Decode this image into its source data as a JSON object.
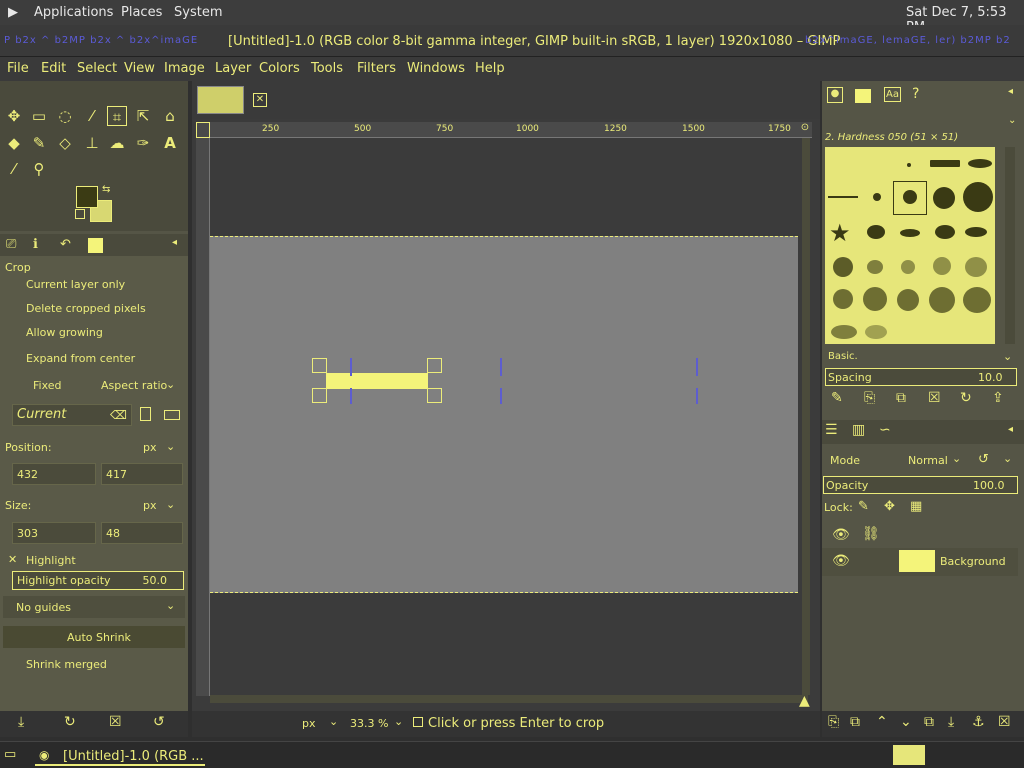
{
  "desktop": {
    "menu": [
      "Applications",
      "Places",
      "System"
    ],
    "clock": "Sat Dec 7, 5:53 PM"
  },
  "window": {
    "title": "[Untitled]-1.0 (RGB color 8-bit gamma integer, GIMP built-in sRGB, 1 layer) 1920x1080 – GIMP"
  },
  "menubar": [
    "File",
    "Edit",
    "Select",
    "View",
    "Image",
    "Layer",
    "Colors",
    "Tools",
    "Filters",
    "Windows",
    "Help"
  ],
  "tool_options": {
    "section": "Crop",
    "current_layer_only": "Current layer only",
    "delete_cropped": "Delete cropped pixels",
    "allow_growing": "Allow growing",
    "expand_from_center": "Expand from center",
    "fixed": "Fixed",
    "aspect": "Aspect ratio",
    "current": "Current",
    "position_label": "Position:",
    "position_unit": "px",
    "pos_x": "432",
    "pos_y": "417",
    "size_label": "Size:",
    "size_unit": "px",
    "size_w": "303",
    "size_h": "48",
    "highlight": "Highlight",
    "highlight_opacity_label": "Highlight opacity",
    "highlight_opacity": "50.0",
    "guides": "No guides",
    "auto_shrink": "Auto Shrink",
    "shrink_merged": "Shrink merged"
  },
  "ruler": {
    "h": [
      "250",
      "500",
      "750",
      "1000",
      "1250",
      "1500",
      "1750"
    ]
  },
  "status": {
    "unit": "px",
    "zoom": "33.3 %",
    "message": "Click or press Enter to crop"
  },
  "brushes": {
    "title": "2. Hardness 050 (51 × 51)",
    "category": "Basic.",
    "spacing_label": "Spacing",
    "spacing": "10.0"
  },
  "layers": {
    "mode_label": "Mode",
    "mode": "Normal",
    "opacity_label": "Opacity",
    "opacity": "100.0",
    "lock_label": "Lock:",
    "layer_name": "Background"
  },
  "taskbar": {
    "item": "[Untitled]-1.0 (RGB ..."
  },
  "colors": {
    "accent": "#ecec7a",
    "canvas": "#808080",
    "fg": "#3b3b14",
    "bg": "#d8d872"
  }
}
